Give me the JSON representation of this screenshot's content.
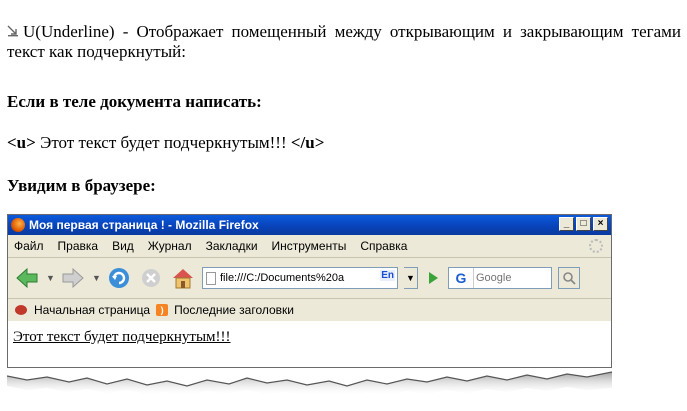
{
  "doc": {
    "para1": "U(Underline) - Отображает помещенный между открывающим и закрывающим тегами текст как подчеркнутый:",
    "heading1": "Если в теле документа написать:",
    "code_open": "<u>",
    "code_text": " Этот текст будет подчеркнутым!!! ",
    "code_close": "</u>",
    "heading2": "Увидим в браузере:"
  },
  "browser": {
    "title": "Моя первая страница ! - Mozilla Firefox",
    "menu": [
      "Файл",
      "Правка",
      "Вид",
      "Журнал",
      "Закладки",
      "Инструменты",
      "Справка"
    ],
    "address": "file:///C:/Documents%20a",
    "lang": "En",
    "search_placeholder": "Google",
    "bookmarks": [
      "Начальная страница",
      "Последние заголовки"
    ],
    "content_text": "Этот текст будет подчеркнутым!!!"
  },
  "colors": {
    "titlebar": "#0842b8",
    "accent": "#1a5fd1"
  }
}
